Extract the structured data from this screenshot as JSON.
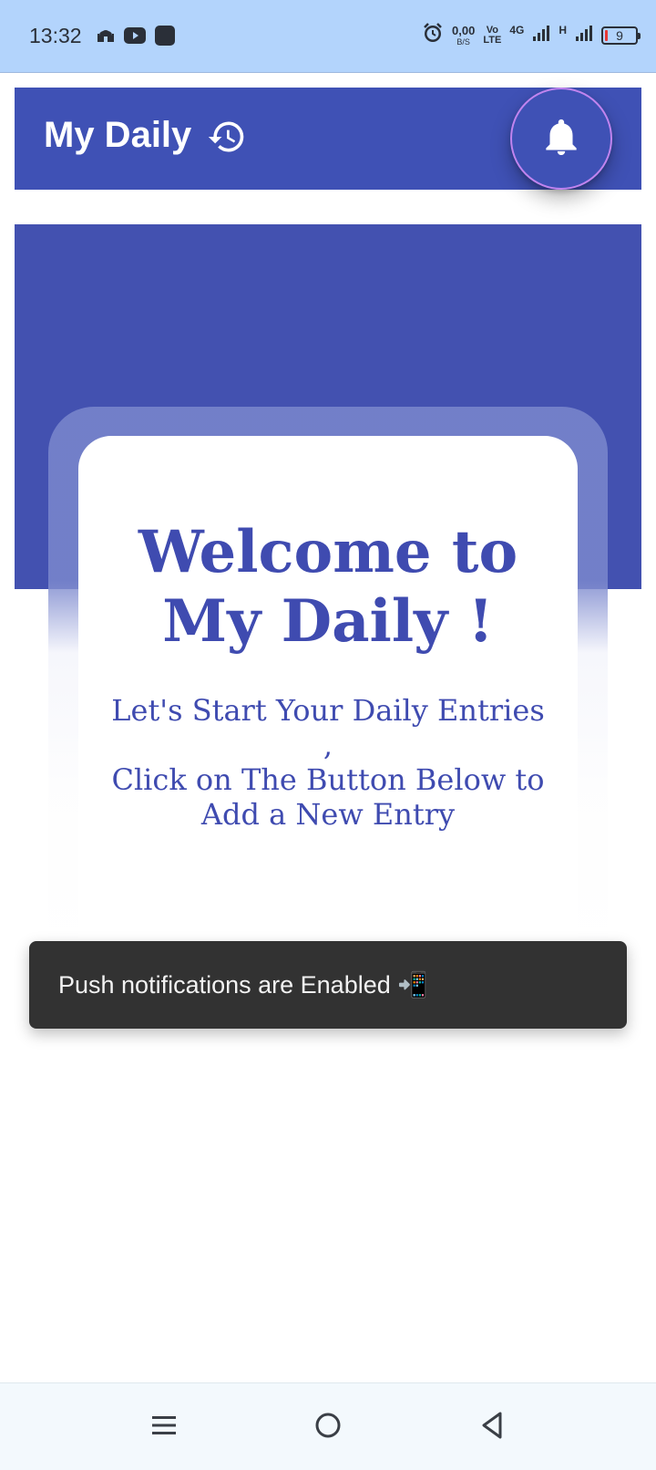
{
  "status_bar": {
    "time": "13:32",
    "net_speed_value": "0,00",
    "net_speed_unit": "B/S",
    "volte_top": "Vo",
    "volte_bottom": "LTE",
    "network_4g": "4G",
    "network_h": "H",
    "battery_level": "9",
    "icons": [
      "mosque-icon",
      "youtube-icon",
      "app-icon",
      "alarm-icon",
      "signal-icon",
      "battery-icon"
    ]
  },
  "app_bar": {
    "title": "My Daily",
    "history_icon": "history-icon",
    "bell_icon": "bell-icon"
  },
  "hero": {
    "title_line1": "Welcome to",
    "title_line2": "My Daily !",
    "subtitle_line1": "Let's Start Your Daily Entries ,",
    "subtitle_line2": "Click on The Button Below to",
    "subtitle_line3": "Add a New Entry"
  },
  "snackbar": {
    "message": "Push notifications are Enabled 📲"
  },
  "nav_bar": {
    "icons": [
      "menu-icon",
      "home-icon",
      "back-icon"
    ]
  },
  "colors": {
    "primary": "#3f51b5",
    "status_bar": "#b3d4fc",
    "fab_ring": "#c084ef",
    "snackbar": "#323232"
  }
}
